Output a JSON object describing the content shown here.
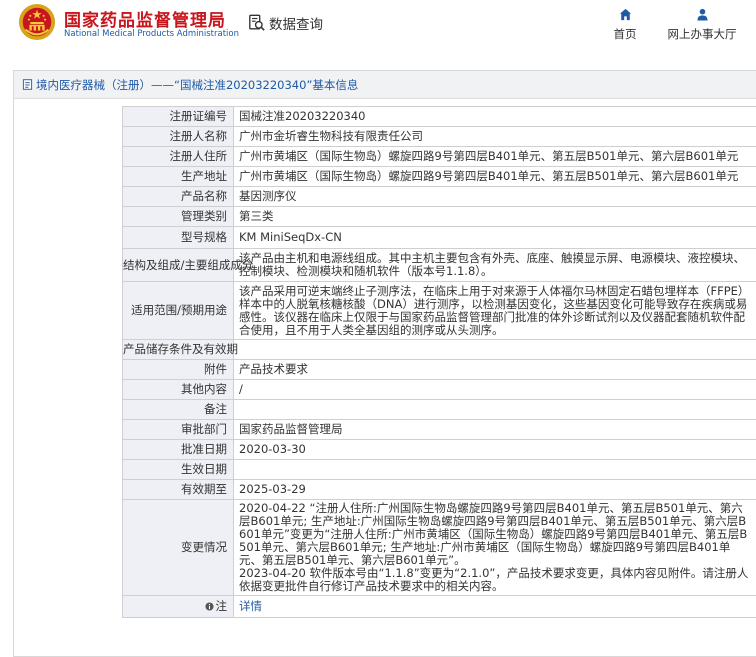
{
  "site": {
    "name_cn": "国家药品监督管理局",
    "name_en": "National Medical Products Administration",
    "search_label": "数据查询",
    "nav": {
      "home": "首页",
      "online_office": "网上办事大厅"
    }
  },
  "breadcrumb": {
    "category": "境内医疗器械（注册）",
    "separator": " —— ",
    "record_title": "“国械注准20203220340”基本信息"
  },
  "record": {
    "rows": [
      {
        "key": "注册证编号",
        "value": "国械注准20203220340"
      },
      {
        "key": "注册人名称",
        "value": "广州市金圻睿生物科技有限责任公司"
      },
      {
        "key": "注册人住所",
        "value": "广州市黄埔区（国际生物岛）螺旋四路9号第四层B401单元、第五层B501单元、第六层B601单元"
      },
      {
        "key": "生产地址",
        "value": "广州市黄埔区（国际生物岛）螺旋四路9号第四层B401单元、第五层B501单元、第六层B601单元"
      },
      {
        "key": "产品名称",
        "value": "基因测序仪"
      },
      {
        "key": "管理类别",
        "value": "第三类"
      },
      {
        "key": "型号规格",
        "value": "KM MiniSeqDx-CN"
      },
      {
        "key": "结构及组成/主要组成成分",
        "value": "该产品由主机和电源线组成。其中主机主要包含有外壳、底座、触摸显示屏、电源模块、液控模块、控制模块、检测模块和随机软件（版本号1.1.8）。"
      },
      {
        "key": "适用范围/预期用途",
        "value": "该产品采用可逆末端终止子测序法，在临床上用于对来源于人体福尔马林固定石蜡包埋样本（FFPE）样本中的人脱氧核糖核酸（DNA）进行测序，以检测基因变化，这些基因变化可能导致存在疾病或易感性。该仪器在临床上仅限于与国家药品监督管理部门批准的体外诊断试剂以及仪器配套随机软件配合使用，且不用于人类全基因组的测序或从头测序。"
      },
      {
        "key": "产品储存条件及有效期",
        "value": ""
      },
      {
        "key": "附件",
        "value": "产品技术要求"
      },
      {
        "key": "其他内容",
        "value": "/"
      },
      {
        "key": "备注",
        "value": ""
      },
      {
        "key": "审批部门",
        "value": "国家药品监督管理局"
      },
      {
        "key": "批准日期",
        "value": "2020-03-30"
      },
      {
        "key": "生效日期",
        "value": ""
      },
      {
        "key": "有效期至",
        "value": "2025-03-29"
      },
      {
        "key": "变更情况",
        "value": "2020-04-22 “注册人住所:广州国际生物岛螺旋四路9号第四层B401单元、第五层B501单元、第六层B601单元; 生产地址:广州国际生物岛螺旋四路9号第四层B401单元、第五层B501单元、第六层B601单元”变更为“注册人住所:广州市黄埔区（国际生物岛）螺旋四路9号第四层B401单元、第五层B501单元、第六层B601单元; 生产地址:广州市黄埔区（国际生物岛）螺旋四路9号第四层B401单元、第五层B501单元、第六层B601单元”。\n2023-04-20 软件版本号由“1.1.8”变更为“2.1.0”，产品技术要求变更，具体内容见附件。请注册人依据变更批件自行修订产品技术要求中的相关内容。"
      }
    ],
    "note_key": "注",
    "note_link": "详情"
  },
  "colors": {
    "brand_red": "#c8161d",
    "brand_blue": "#1f5aa6",
    "label_cell_bg": "#eef0f5",
    "title_bar_bg": "#f1f2f4",
    "border": "#cfcfcf"
  },
  "icons": {
    "emblem": "national-emblem",
    "search": "search-document-icon",
    "home": "home-icon",
    "office": "user-icon",
    "breadcrumb": "page-icon",
    "note": "info-circle-icon"
  }
}
